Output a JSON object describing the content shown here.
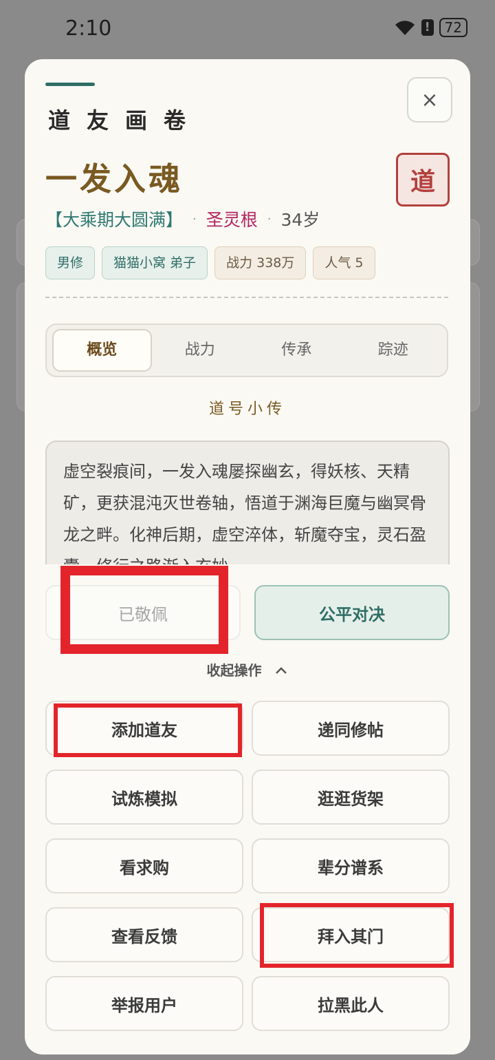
{
  "status": {
    "time": "2:10",
    "battery": "72",
    "alert": "!"
  },
  "modal": {
    "title": "道友画卷",
    "close_label": "×",
    "name": "一发入魂",
    "stamp": "道",
    "realm": "【大乘期大圆满】",
    "separator": "·",
    "root": "圣灵根",
    "age": "34岁",
    "tags": [
      "男修",
      "猫猫小窝 弟子",
      "战力 338万",
      "人气 5"
    ],
    "tabs": [
      "概览",
      "战力",
      "传承",
      "踪迹"
    ],
    "active_tab": "概览",
    "section_title": "道号小传",
    "bio": "虚空裂痕间，一发入魂屡探幽玄，得妖核、天精矿，更获混沌灭世卷轴，悟道于渊海巨魔与幽冥骨龙之畔。化神后期，虚空淬体，斩魔夺宝，灵石盈囊，修行之路渐入玄妙。",
    "admire_label": "已敬佩",
    "duel_label": "公平对决",
    "collapse_label": "收起操作",
    "actions": [
      "添加道友",
      "递同修帖",
      "试炼模拟",
      "逛逛货架",
      "看求购",
      "辈分谱系",
      "查看反馈",
      "拜入其门",
      "举报用户",
      "拉黑此人"
    ]
  },
  "colors": {
    "accent": "#2f6e66",
    "name": "#7a5a22",
    "stamp": "#b3403c",
    "root": "#b2245f",
    "highlight": "#e3242b"
  }
}
